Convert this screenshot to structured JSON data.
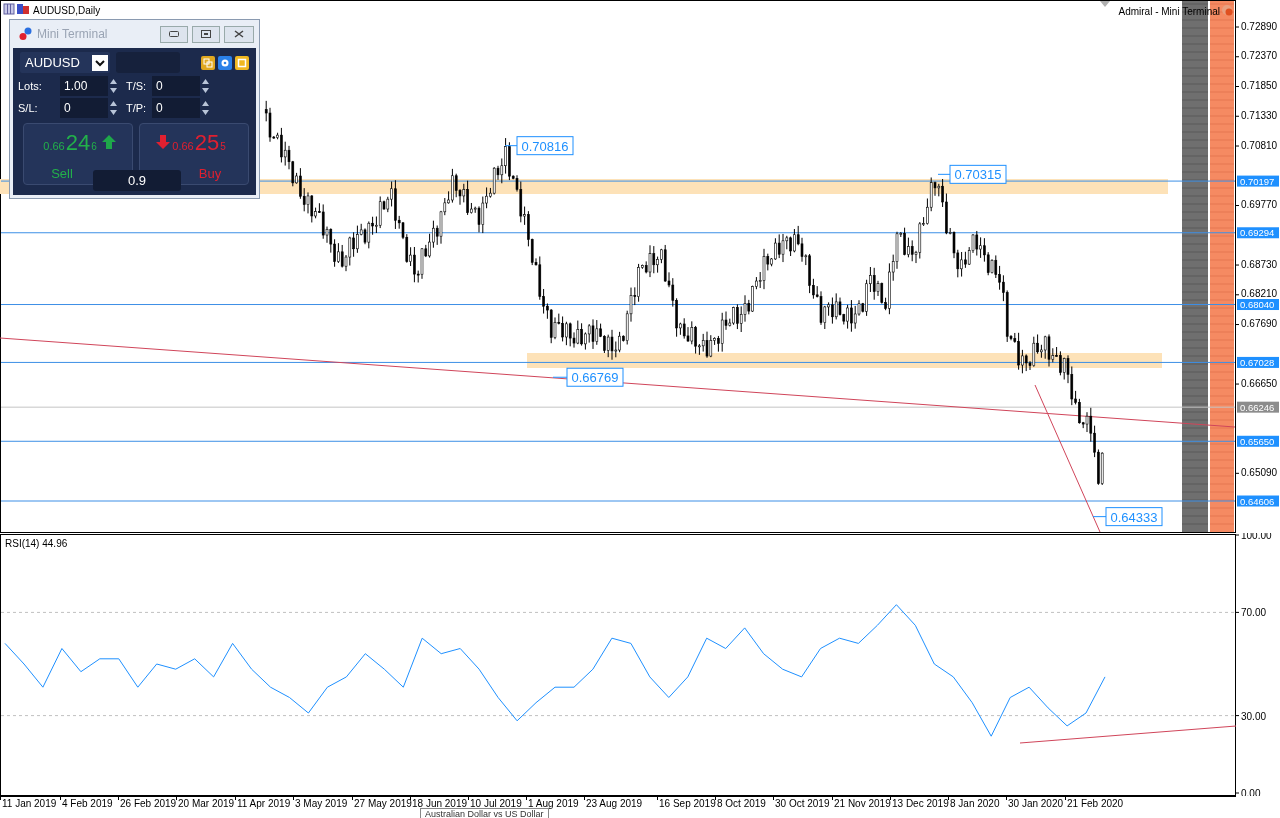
{
  "chart_header": {
    "symbol": "AUDUSD,Daily",
    "expert": "Admiral - Mini Terminal"
  },
  "mini_terminal": {
    "title": "Mini Terminal",
    "symbol": "AUDUSD",
    "fields": [
      {
        "label": "Lots:",
        "value": "1.00"
      },
      {
        "label": "T/S:",
        "value": "0"
      },
      {
        "label": "S/L:",
        "value": "0"
      },
      {
        "label": "T/P:",
        "value": "0"
      }
    ],
    "sell": {
      "price_prefix": "0.66",
      "price_big": "24",
      "price_small": "6",
      "label": "Sell"
    },
    "buy": {
      "price_prefix": "0.66",
      "price_big": "25",
      "price_small": "5",
      "label": "Buy"
    },
    "spread": "0.9"
  },
  "price_axis": {
    "ticks": [
      "0.72890",
      "0.72370",
      "0.71850",
      "0.71330",
      "0.70810",
      "0.69770",
      "0.68730",
      "0.68210",
      "0.67690",
      "0.66650",
      "0.65090"
    ],
    "levels": [
      {
        "label": "0.70197",
        "kind": "level"
      },
      {
        "label": "0.69294",
        "kind": "level"
      },
      {
        "label": "0.68040",
        "kind": "level"
      },
      {
        "label": "0.67028",
        "kind": "level"
      },
      {
        "label": "0.66246",
        "kind": "bid"
      },
      {
        "label": "0.65650",
        "kind": "level"
      },
      {
        "label": "0.64606",
        "kind": "level"
      }
    ]
  },
  "callouts": [
    {
      "label": "0.70816"
    },
    {
      "label": "0.70315"
    },
    {
      "label": "0.66769"
    },
    {
      "label": "0.64333"
    }
  ],
  "rsi": {
    "chart_data": {
      "type": "line",
      "title": "RSI(14) 44.96",
      "ylim": [
        0,
        100
      ],
      "yticks": [
        {
          "value": 100,
          "label": "100.00"
        },
        {
          "value": 70,
          "label": "70.00"
        },
        {
          "value": 30,
          "label": "30.00"
        },
        {
          "value": 0,
          "label": "0.00"
        }
      ],
      "series": [
        {
          "color": "#1e90ff",
          "values": [
            58,
            50,
            41,
            56,
            47,
            52,
            52,
            41,
            50,
            48,
            52,
            45,
            58,
            48,
            41,
            37,
            31,
            41,
            45,
            54,
            48,
            41,
            60,
            54,
            56,
            48,
            37,
            28,
            35,
            41,
            41,
            48,
            60,
            58,
            45,
            37,
            45,
            60,
            56,
            64,
            54,
            48,
            45,
            56,
            60,
            58,
            65,
            73,
            65,
            50,
            45,
            35,
            22,
            37,
            41,
            33,
            26,
            31,
            45
          ]
        }
      ]
    }
  },
  "time_axis": {
    "labels": [
      "11 Jan 2019",
      "4 Feb 2019",
      "26 Feb 2019",
      "20 Mar 2019",
      "11 Apr 2019",
      "3 May 2019",
      "27 May 2019",
      "18 Jun 2019",
      "10 Jul 2019",
      "1 Aug 2019",
      "23 Aug 2019",
      "16 Sep 2019",
      "8 Oct 2019",
      "30 Oct 2019",
      "21 Nov 2019",
      "13 Dec 2019",
      "8 Jan 2020",
      "30 Jan 2020",
      "21 Feb 2020"
    ]
  },
  "tooltip": "Australian Dollar vs US Dollar"
}
